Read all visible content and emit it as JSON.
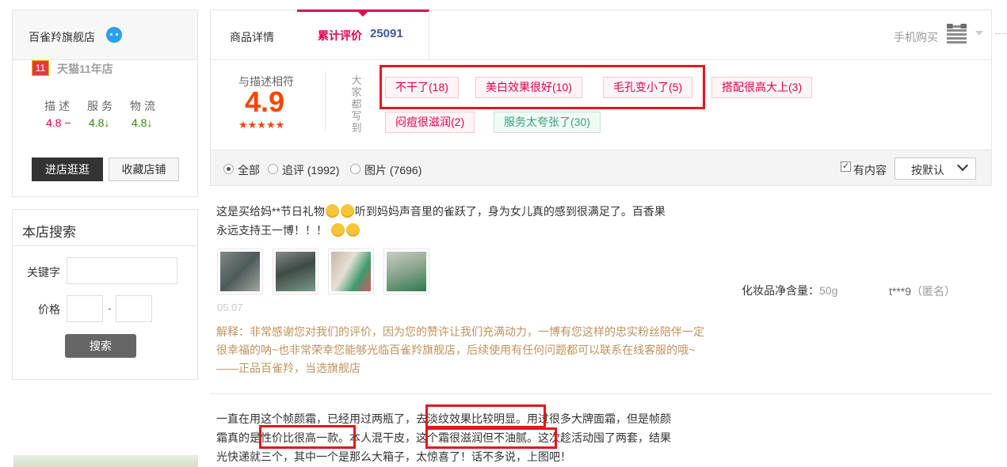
{
  "shop": {
    "name": "百雀羚旗舰店",
    "tmall_badge": "11",
    "tmall_age": "天猫11年店",
    "ratings": [
      {
        "label": "描述",
        "value": "4.8",
        "trend": "−",
        "color": "#e5004f"
      },
      {
        "label": "服务",
        "value": "4.8",
        "trend": "↓",
        "color": "#2f8a00"
      },
      {
        "label": "物流",
        "value": "4.8",
        "trend": "↓",
        "color": "#2f8a00"
      }
    ],
    "enter_button": "进店逛逛",
    "favorite_button": "收藏店铺"
  },
  "store_search": {
    "title": "本店搜索",
    "keyword_label": "关键字",
    "price_label": "价格",
    "dash": "-",
    "search_button": "搜索"
  },
  "tabs": {
    "detail": "商品详情",
    "reviews": "累计评价",
    "reviews_count": "25091",
    "mobile_buy": "手机购买"
  },
  "summary": {
    "desc_label": "与描述相符",
    "score": "4.9",
    "stars": "★★★★★",
    "everyone_wrote": [
      "大",
      "家",
      "都",
      "写",
      "到"
    ],
    "tags": [
      {
        "text": "不干了(18)",
        "kind": "bad"
      },
      {
        "text": "美白效果很好(10)",
        "kind": "bad"
      },
      {
        "text": "毛孔变小了(5)",
        "kind": "bad"
      },
      {
        "text": "搭配很高大上(3)",
        "kind": "bad"
      },
      {
        "text": "闷痘很滋润(2)",
        "kind": "bad"
      },
      {
        "text": "服务太夸张了(30)",
        "kind": "good"
      }
    ]
  },
  "filter": {
    "all": "全部",
    "followup": "追评 (1992)",
    "pictures": "图片 (7696)",
    "has_content": "有内容",
    "sort": "按默认"
  },
  "reviews": [
    {
      "text_a": "这是买给妈**节日礼物",
      "text_b": "听到妈妈声音里的雀跃了，身为女儿真的感到很满足了。百香果",
      "text_c": "永远支持王一博！！！",
      "date": "05.07",
      "reply": "解释：非常感谢您对我们的评价，因为您的赞许让我们充满动力，一博有您这样的忠实粉丝陪伴一定很幸福的呐~也非常荣幸您能够光临百雀羚旗舰店，后续使用有任何问题都可以联系在线客服的哦~——正品百雀羚，当选旗舰店",
      "spec_label": "化妆品净含量：",
      "spec_value": "50g",
      "user": "t***9",
      "anon": "（匿名）"
    },
    {
      "p1": "一直在用这个帧颜霜，已经用过两瓶了，",
      "h1": "去淡纹效果比较明显。",
      "p2": "用过很多大牌面霜，但是帧颜",
      "p3": "霜真的是",
      "h2": "性价比很高一款。",
      "p4": "本人混干皮，",
      "h3": "这个霜很滋润但不油腻。",
      "p5": "这次趁活动囤了两套，结果",
      "p6": "光快递就三个，其中一个是那么大箱子，太惊喜了！话不多说，上图吧！"
    }
  ],
  "colors": {
    "accent": "#e5004f",
    "score": "#ff4400",
    "reply": "#c0935c",
    "highlight_box": "#e4161f"
  }
}
